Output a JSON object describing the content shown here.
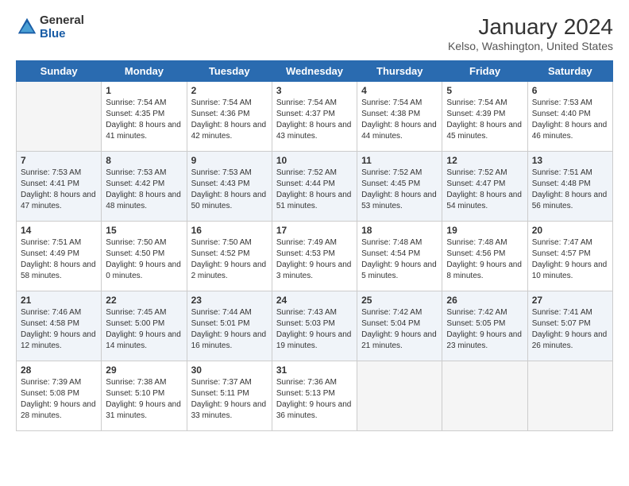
{
  "logo": {
    "general": "General",
    "blue": "Blue"
  },
  "title": "January 2024",
  "subtitle": "Kelso, Washington, United States",
  "days_of_week": [
    "Sunday",
    "Monday",
    "Tuesday",
    "Wednesday",
    "Thursday",
    "Friday",
    "Saturday"
  ],
  "weeks": [
    [
      {
        "day": "",
        "empty": true
      },
      {
        "day": "1",
        "sunrise": "Sunrise: 7:54 AM",
        "sunset": "Sunset: 4:35 PM",
        "daylight": "Daylight: 8 hours and 41 minutes."
      },
      {
        "day": "2",
        "sunrise": "Sunrise: 7:54 AM",
        "sunset": "Sunset: 4:36 PM",
        "daylight": "Daylight: 8 hours and 42 minutes."
      },
      {
        "day": "3",
        "sunrise": "Sunrise: 7:54 AM",
        "sunset": "Sunset: 4:37 PM",
        "daylight": "Daylight: 8 hours and 43 minutes."
      },
      {
        "day": "4",
        "sunrise": "Sunrise: 7:54 AM",
        "sunset": "Sunset: 4:38 PM",
        "daylight": "Daylight: 8 hours and 44 minutes."
      },
      {
        "day": "5",
        "sunrise": "Sunrise: 7:54 AM",
        "sunset": "Sunset: 4:39 PM",
        "daylight": "Daylight: 8 hours and 45 minutes."
      },
      {
        "day": "6",
        "sunrise": "Sunrise: 7:53 AM",
        "sunset": "Sunset: 4:40 PM",
        "daylight": "Daylight: 8 hours and 46 minutes."
      }
    ],
    [
      {
        "day": "7",
        "sunrise": "Sunrise: 7:53 AM",
        "sunset": "Sunset: 4:41 PM",
        "daylight": "Daylight: 8 hours and 47 minutes."
      },
      {
        "day": "8",
        "sunrise": "Sunrise: 7:53 AM",
        "sunset": "Sunset: 4:42 PM",
        "daylight": "Daylight: 8 hours and 48 minutes."
      },
      {
        "day": "9",
        "sunrise": "Sunrise: 7:53 AM",
        "sunset": "Sunset: 4:43 PM",
        "daylight": "Daylight: 8 hours and 50 minutes."
      },
      {
        "day": "10",
        "sunrise": "Sunrise: 7:52 AM",
        "sunset": "Sunset: 4:44 PM",
        "daylight": "Daylight: 8 hours and 51 minutes."
      },
      {
        "day": "11",
        "sunrise": "Sunrise: 7:52 AM",
        "sunset": "Sunset: 4:45 PM",
        "daylight": "Daylight: 8 hours and 53 minutes."
      },
      {
        "day": "12",
        "sunrise": "Sunrise: 7:52 AM",
        "sunset": "Sunset: 4:47 PM",
        "daylight": "Daylight: 8 hours and 54 minutes."
      },
      {
        "day": "13",
        "sunrise": "Sunrise: 7:51 AM",
        "sunset": "Sunset: 4:48 PM",
        "daylight": "Daylight: 8 hours and 56 minutes."
      }
    ],
    [
      {
        "day": "14",
        "sunrise": "Sunrise: 7:51 AM",
        "sunset": "Sunset: 4:49 PM",
        "daylight": "Daylight: 8 hours and 58 minutes."
      },
      {
        "day": "15",
        "sunrise": "Sunrise: 7:50 AM",
        "sunset": "Sunset: 4:50 PM",
        "daylight": "Daylight: 9 hours and 0 minutes."
      },
      {
        "day": "16",
        "sunrise": "Sunrise: 7:50 AM",
        "sunset": "Sunset: 4:52 PM",
        "daylight": "Daylight: 9 hours and 2 minutes."
      },
      {
        "day": "17",
        "sunrise": "Sunrise: 7:49 AM",
        "sunset": "Sunset: 4:53 PM",
        "daylight": "Daylight: 9 hours and 3 minutes."
      },
      {
        "day": "18",
        "sunrise": "Sunrise: 7:48 AM",
        "sunset": "Sunset: 4:54 PM",
        "daylight": "Daylight: 9 hours and 5 minutes."
      },
      {
        "day": "19",
        "sunrise": "Sunrise: 7:48 AM",
        "sunset": "Sunset: 4:56 PM",
        "daylight": "Daylight: 9 hours and 8 minutes."
      },
      {
        "day": "20",
        "sunrise": "Sunrise: 7:47 AM",
        "sunset": "Sunset: 4:57 PM",
        "daylight": "Daylight: 9 hours and 10 minutes."
      }
    ],
    [
      {
        "day": "21",
        "sunrise": "Sunrise: 7:46 AM",
        "sunset": "Sunset: 4:58 PM",
        "daylight": "Daylight: 9 hours and 12 minutes."
      },
      {
        "day": "22",
        "sunrise": "Sunrise: 7:45 AM",
        "sunset": "Sunset: 5:00 PM",
        "daylight": "Daylight: 9 hours and 14 minutes."
      },
      {
        "day": "23",
        "sunrise": "Sunrise: 7:44 AM",
        "sunset": "Sunset: 5:01 PM",
        "daylight": "Daylight: 9 hours and 16 minutes."
      },
      {
        "day": "24",
        "sunrise": "Sunrise: 7:43 AM",
        "sunset": "Sunset: 5:03 PM",
        "daylight": "Daylight: 9 hours and 19 minutes."
      },
      {
        "day": "25",
        "sunrise": "Sunrise: 7:42 AM",
        "sunset": "Sunset: 5:04 PM",
        "daylight": "Daylight: 9 hours and 21 minutes."
      },
      {
        "day": "26",
        "sunrise": "Sunrise: 7:42 AM",
        "sunset": "Sunset: 5:05 PM",
        "daylight": "Daylight: 9 hours and 23 minutes."
      },
      {
        "day": "27",
        "sunrise": "Sunrise: 7:41 AM",
        "sunset": "Sunset: 5:07 PM",
        "daylight": "Daylight: 9 hours and 26 minutes."
      }
    ],
    [
      {
        "day": "28",
        "sunrise": "Sunrise: 7:39 AM",
        "sunset": "Sunset: 5:08 PM",
        "daylight": "Daylight: 9 hours and 28 minutes."
      },
      {
        "day": "29",
        "sunrise": "Sunrise: 7:38 AM",
        "sunset": "Sunset: 5:10 PM",
        "daylight": "Daylight: 9 hours and 31 minutes."
      },
      {
        "day": "30",
        "sunrise": "Sunrise: 7:37 AM",
        "sunset": "Sunset: 5:11 PM",
        "daylight": "Daylight: 9 hours and 33 minutes."
      },
      {
        "day": "31",
        "sunrise": "Sunrise: 7:36 AM",
        "sunset": "Sunset: 5:13 PM",
        "daylight": "Daylight: 9 hours and 36 minutes."
      },
      {
        "day": "",
        "empty": true
      },
      {
        "day": "",
        "empty": true
      },
      {
        "day": "",
        "empty": true
      }
    ]
  ]
}
